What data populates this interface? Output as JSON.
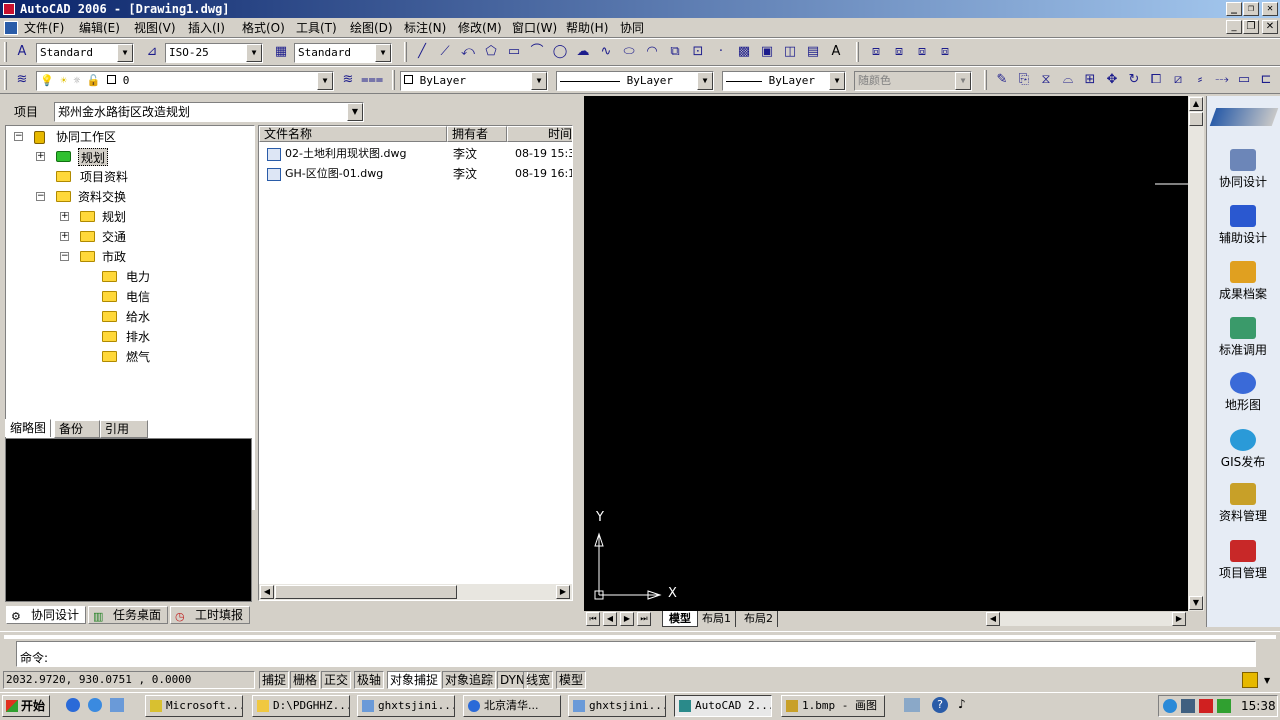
{
  "title": "AutoCAD 2006 - [Drawing1.dwg]",
  "menu": [
    "文件(F)",
    "编辑(E)",
    "视图(V)",
    "插入(I)",
    "格式(O)",
    "工具(T)",
    "绘图(D)",
    "标注(N)",
    "修改(M)",
    "窗口(W)",
    "帮助(H)",
    "协同"
  ],
  "toolbar1": {
    "text_style": "Standard",
    "dim_style": "ISO-25",
    "table_style": "Standard"
  },
  "toolbar2": {
    "layer": "0",
    "color": "ByLayer",
    "linetype": "ByLayer",
    "lineweight": "ByLayer",
    "plot_style": "随颜色"
  },
  "project": {
    "label": "项目",
    "value": "郑州金水路街区改造规划"
  },
  "tree": {
    "root": "协同工作区",
    "planning": "规划",
    "project_data": "项目资料",
    "exchange": "资料交换",
    "sub_planning": "规划",
    "traffic": "交通",
    "municipal": "市政",
    "power": "电力",
    "telecom": "电信",
    "water_supply": "给水",
    "drainage": "排水",
    "gas": "燃气"
  },
  "files": {
    "col_name": "文件名称",
    "col_owner": "拥有者",
    "col_time": "时间",
    "rows": [
      {
        "name": "02-土地利用现状图.dwg",
        "owner": "李汶",
        "time": "08-19 15:3"
      },
      {
        "name": "GH-区位图-01.dwg",
        "owner": "李汶",
        "time": "08-19 16:1"
      }
    ]
  },
  "thumb_tabs": [
    "缩略图",
    "备份",
    "引用"
  ],
  "bottom_tabs": [
    "协同设计",
    "任务桌面",
    "工时填报"
  ],
  "layout_tabs": [
    "模型",
    "布局1",
    "布局2"
  ],
  "axis": {
    "x": "X",
    "y": "Y"
  },
  "sidebar": [
    "协同设计",
    "辅助设计",
    "成果档案",
    "标准调用",
    "地形图",
    "GIS发布",
    "资料管理",
    "项目管理"
  ],
  "command": "命令:",
  "coords": "2032.9720, 930.0751 , 0.0000",
  "status_buttons": [
    "捕捉",
    "栅格",
    "正交",
    "极轴",
    "对象捕捉",
    "对象追踪",
    "DYN",
    "线宽",
    "模型"
  ],
  "taskbar": {
    "start": "开始",
    "tasks": [
      "Microsoft...",
      "D:\\PDGHHZ...",
      "ghxtsjini...",
      "北京清华...",
      "ghxtsjini...",
      "AutoCAD 2...",
      "1.bmp - 画图"
    ],
    "clock": "15:38"
  },
  "colors": {
    "title_start": "#0a246a",
    "title_end": "#a6caf0",
    "canvas": "#000000",
    "face": "#d4d0c8"
  }
}
